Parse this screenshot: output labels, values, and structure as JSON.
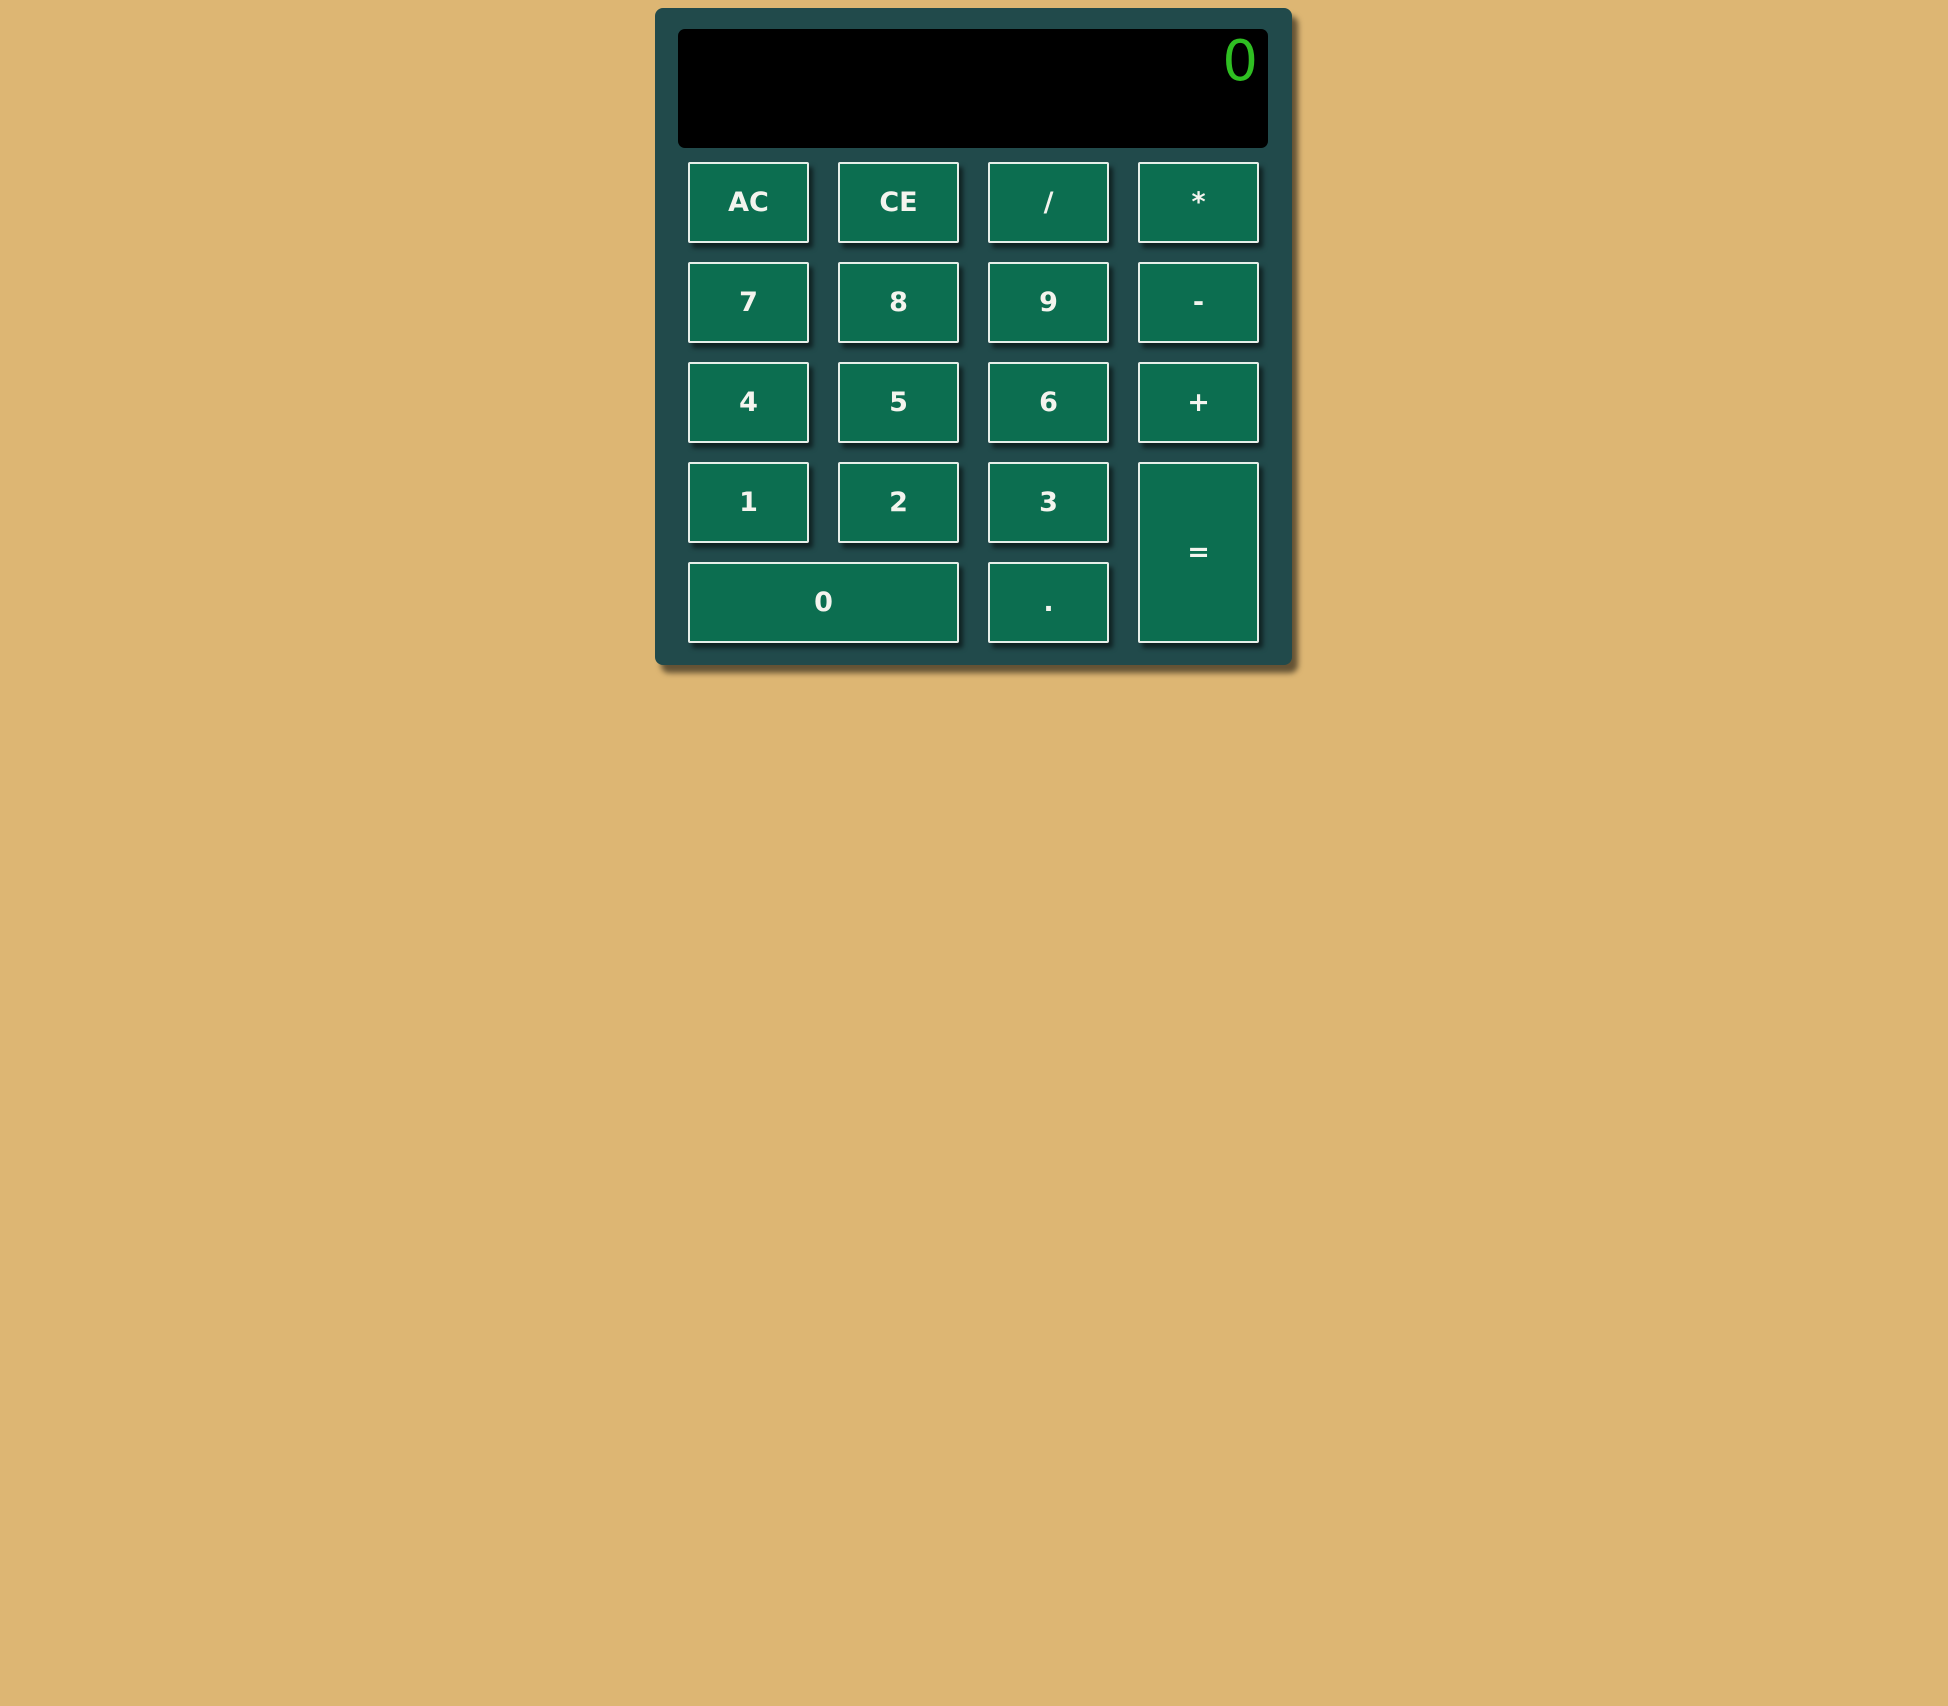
{
  "calculator": {
    "display": "0",
    "keys": {
      "ac": "AC",
      "ce": "CE",
      "divide": "/",
      "multiply": "*",
      "seven": "7",
      "eight": "8",
      "nine": "9",
      "subtract": "-",
      "four": "4",
      "five": "5",
      "six": "6",
      "add": "+",
      "one": "1",
      "two": "2",
      "three": "3",
      "equals": "=",
      "zero": "0",
      "decimal": "."
    }
  },
  "colors": {
    "page_background": "#ddb673",
    "calculator_body": "#214a4b",
    "display_background": "#000000",
    "display_text": "#2fbf22",
    "key_background": "#0c6e50",
    "key_text": "#f4f4ee"
  }
}
